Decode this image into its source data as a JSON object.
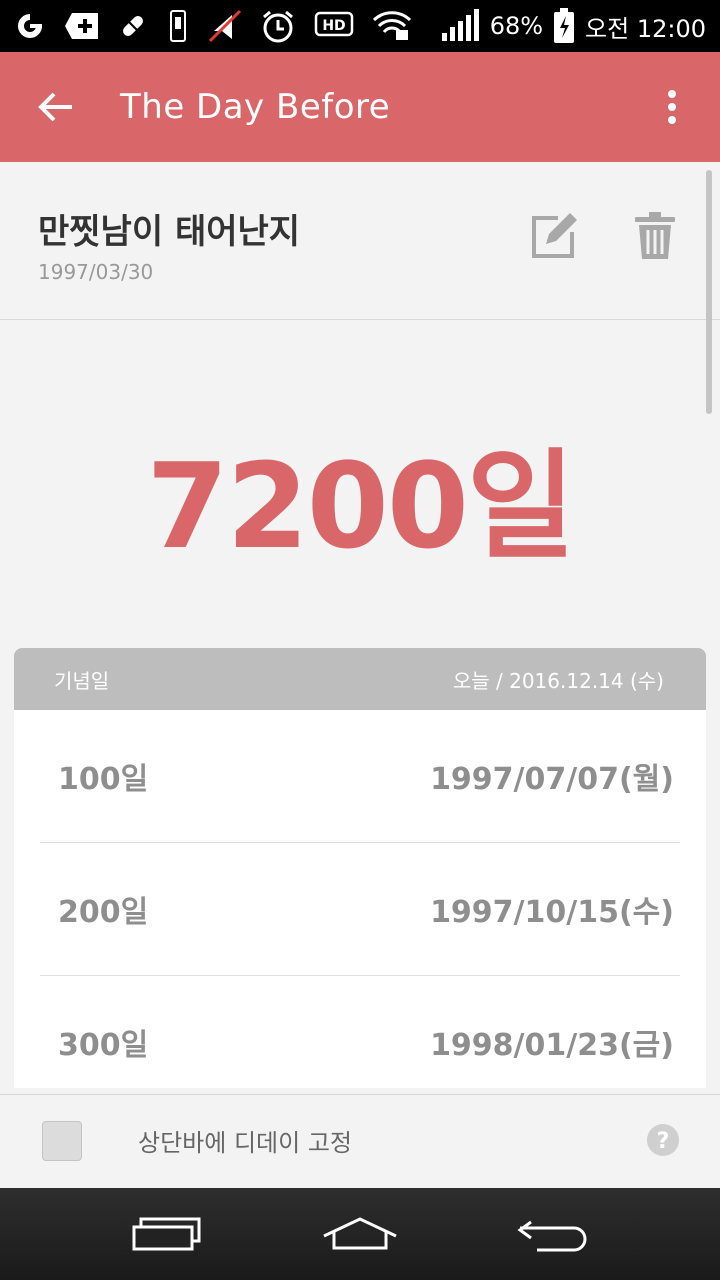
{
  "status_bar": {
    "battery": "68%",
    "time": "오전 12:00",
    "icons": [
      "lg-icon",
      "plus-badge-icon",
      "pill-icon",
      "usb-icon",
      "mute-icon",
      "alarm-icon",
      "hd-icon",
      "wifi-lock-icon",
      "signal-icon",
      "battery-charging-icon"
    ]
  },
  "app_bar": {
    "title": "The Day Before",
    "back_icon": "arrow-left-icon",
    "menu_icon": "more-vert-icon"
  },
  "event": {
    "title": "만찟남이 태어난지",
    "date": "1997/03/30",
    "edit_icon": "edit-icon",
    "delete_icon": "trash-icon"
  },
  "day_count": "7200일",
  "anniversary": {
    "header_label": "기념일",
    "today_label": "오늘 / 2016.12.14 (수)",
    "rows": [
      {
        "days": "100일",
        "date": "1997/07/07(월)"
      },
      {
        "days": "200일",
        "date": "1997/10/15(수)"
      },
      {
        "days": "300일",
        "date": "1998/01/23(금)"
      }
    ]
  },
  "bottom": {
    "pin_label": "상단바에 디데이 고정",
    "pin_checked": false
  },
  "colors": {
    "accent": "#d9676a",
    "header_gray": "#bdbdbd"
  }
}
